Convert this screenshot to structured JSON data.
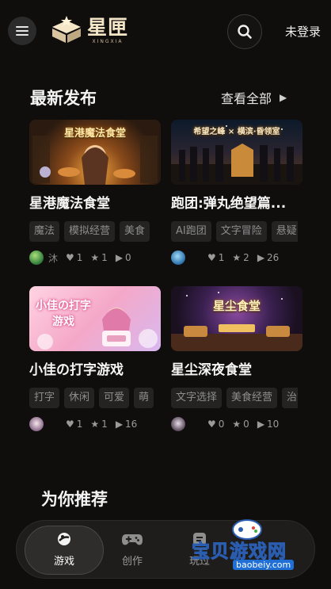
{
  "header": {
    "logo_cn": "星匣",
    "logo_en": "XINGXIA",
    "login_label": "未登录"
  },
  "latest": {
    "title": "最新发布",
    "see_all_label": "查看全部",
    "cards": [
      {
        "cover_caption": "星港魔法食堂",
        "title": "星港魔法食堂",
        "tags": [
          "魔法",
          "模拟经营",
          "美食"
        ],
        "author": "沐",
        "likes": "1",
        "stars": "1",
        "plays": "0"
      },
      {
        "cover_caption": "希望之峰 × 横滨·昏领室",
        "title": "跑团:弹丸绝望篇...",
        "tags": [
          "AI跑团",
          "文字冒险",
          "悬疑"
        ],
        "author": "",
        "likes": "1",
        "stars": "2",
        "plays": "26"
      },
      {
        "cover_caption": "小佳の打字游戏",
        "title": "小佳の打字游戏",
        "tags": [
          "打字",
          "休闲",
          "可爱",
          "萌"
        ],
        "author": "",
        "likes": "1",
        "stars": "1",
        "plays": "16"
      },
      {
        "cover_caption": "星尘食堂",
        "title": "星尘深夜食堂",
        "tags": [
          "文字选择",
          "美食经营",
          "治愈"
        ],
        "author": "",
        "likes": "0",
        "stars": "0",
        "plays": "10"
      }
    ]
  },
  "recommend": {
    "title": "为你推荐"
  },
  "tabbar": {
    "tabs": [
      {
        "label": "游戏",
        "icon": "game-planet-icon",
        "active": true
      },
      {
        "label": "创作",
        "icon": "gamepad-icon",
        "active": false
      },
      {
        "label": "玩过",
        "icon": "history-icon",
        "active": false
      }
    ]
  },
  "watermark": {
    "text": "宝贝游戏网",
    "url": "baobeiy.com"
  },
  "colors": {
    "background": "#0f0e0d",
    "tag_bg": "#242322",
    "accent_gold": "#f6e6c8"
  }
}
